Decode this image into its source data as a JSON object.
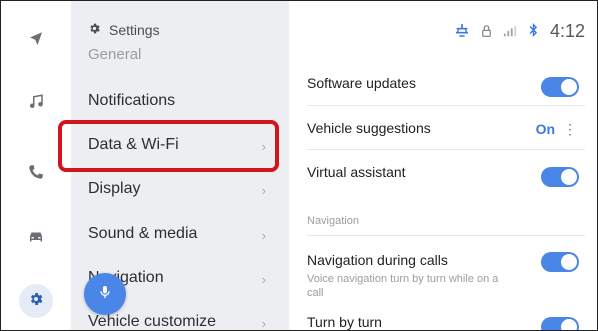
{
  "status": {
    "time": "4:12",
    "icons": [
      "car-status-icon",
      "lock-icon",
      "signal-icon",
      "bluetooth-icon"
    ]
  },
  "rail": {
    "icons": [
      "navigation-icon",
      "music-icon",
      "phone-icon",
      "car-icon",
      "settings-icon"
    ]
  },
  "menu": {
    "header": "Settings",
    "subheader": "General",
    "items": [
      {
        "label": "Notifications",
        "chevron": false
      },
      {
        "label": "Data & Wi-Fi",
        "chevron": true
      },
      {
        "label": "Display",
        "chevron": true
      },
      {
        "label": "Sound & media",
        "chevron": true
      },
      {
        "label": "Navigation",
        "chevron": true
      },
      {
        "label": "Vehicle customize",
        "chevron": true
      }
    ]
  },
  "main": {
    "rows": [
      {
        "label": "Software updates",
        "control": "toggle",
        "on": true
      },
      {
        "label": "Vehicle suggestions",
        "control": "value",
        "value": "On"
      },
      {
        "label": "Virtual assistant",
        "control": "toggle",
        "on": true
      }
    ],
    "section_label": "Navigation",
    "nav_rows": [
      {
        "label": "Navigation during calls",
        "desc": "Voice navigation turn by turn while on a call",
        "control": "toggle",
        "on": true
      },
      {
        "label": "Turn by turn",
        "control": "toggle",
        "on": true
      }
    ]
  },
  "colors": {
    "accent": "#4a86e8",
    "highlight": "#d2141d",
    "menu_bg": "#eceef1"
  }
}
